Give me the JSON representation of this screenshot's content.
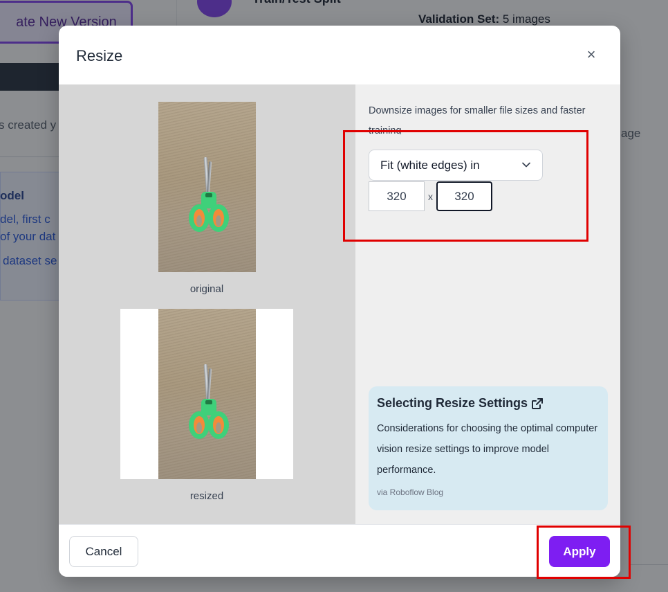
{
  "background": {
    "create_button_label": "ate New Version",
    "created_text": "s created y",
    "info_title": "odel",
    "info_lines": [
      "del, first c",
      "of your dat",
      "dataset se"
    ],
    "split_title": "Train/Test Split",
    "validation_label": "Validation Set:",
    "validation_value": "5 images",
    "side_word": "age"
  },
  "modal": {
    "title": "Resize",
    "close_symbol": "×",
    "preview": {
      "original_caption": "original",
      "resized_caption": "resized"
    },
    "settings": {
      "description": "Downsize images for smaller file sizes and faster training",
      "mode_selected": "Fit (white edges) in",
      "width_value": "320",
      "separator": "x",
      "height_value": "320"
    },
    "blog_card": {
      "title": "Selecting Resize Settings",
      "description": "Considerations for choosing the optimal computer vision resize settings to improve model performance.",
      "source": "via Roboflow Blog"
    },
    "footer": {
      "cancel_label": "Cancel",
      "apply_label": "Apply"
    }
  },
  "colors": {
    "accent": "#7e1ef2",
    "highlight": "#e00000",
    "blog_card_bg": "#d7eaf2"
  }
}
